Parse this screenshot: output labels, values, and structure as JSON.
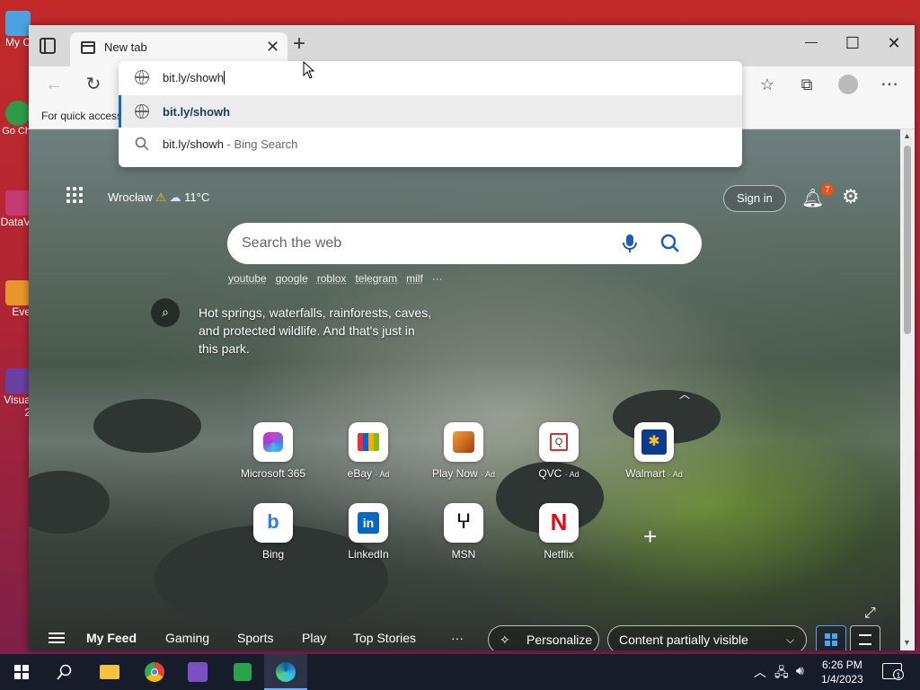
{
  "desktop": {
    "icons": [
      {
        "label": "My C"
      },
      {
        "label": "Go Ch"
      },
      {
        "label": "DataV"
      },
      {
        "label": "Eve"
      },
      {
        "label": "Visua 2"
      }
    ]
  },
  "browser": {
    "tab": {
      "title": "New tab",
      "close": "✕"
    },
    "new_tab": "+",
    "window_controls": {
      "minimize": "—",
      "maximize": "☐",
      "close": "✕"
    },
    "favorites_bar_text": "For quick access"
  },
  "address_dropdown": {
    "input_value": "bit.ly/showh",
    "suggestions": [
      {
        "text": "bit.ly/showh",
        "type": "url"
      },
      {
        "text": "bit.ly/showh",
        "suffix": " - Bing Search",
        "type": "search"
      }
    ]
  },
  "newtab": {
    "weather": {
      "city": "Wrocław",
      "temp": "11°C"
    },
    "sign_in": "Sign in",
    "notifications_count": "7",
    "search_placeholder": "Search the web",
    "trending": [
      "youtube",
      "google",
      "roblox",
      "telegram",
      "milf",
      "···"
    ],
    "caption": "Hot springs, waterfalls, rainforests, caves, and protected wildlife. And that's just in this park.",
    "tiles": [
      {
        "label": "Microsoft 365",
        "ad": ""
      },
      {
        "label": "eBay",
        "ad": "· Ad"
      },
      {
        "label": "Play Now",
        "ad": "· Ad"
      },
      {
        "label": "QVC",
        "ad": "· Ad"
      },
      {
        "label": "Walmart",
        "ad": "· Ad"
      },
      {
        "label": "Bing",
        "ad": ""
      },
      {
        "label": "LinkedIn",
        "ad": ""
      },
      {
        "label": "MSN",
        "ad": ""
      },
      {
        "label": "Netflix",
        "ad": ""
      }
    ],
    "feed": {
      "links": [
        "My Feed",
        "Gaming",
        "Sports",
        "Play",
        "Top Stories"
      ],
      "more": "···",
      "personalize": "Personalize",
      "content_visibility": "Content partially visible"
    }
  },
  "taskbar": {
    "time": "6:26 PM",
    "date": "1/4/2023",
    "notification_count": "1"
  },
  "colors": {
    "accent": "#0f6cbd",
    "badge": "#e5541b",
    "taskbar": "#161c2a"
  }
}
